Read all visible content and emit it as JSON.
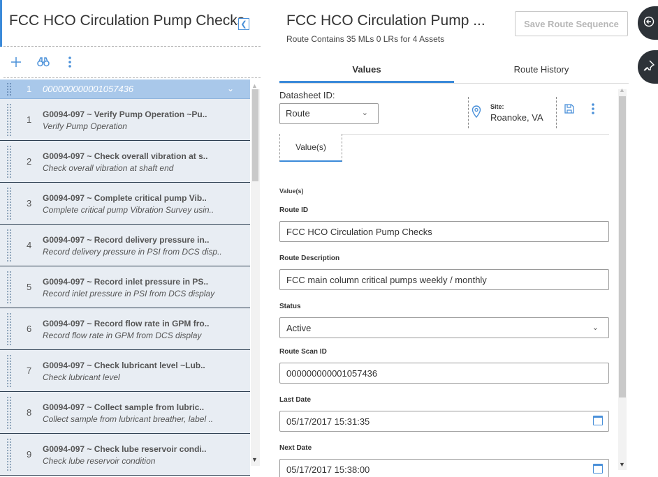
{
  "left": {
    "title": "FCC HCO Circulation Pump Checks",
    "group": {
      "number": "1",
      "label": "000000000001057436"
    },
    "items": [
      {
        "number": "1",
        "title": "G0094-097 ~ Verify Pump Operation ~Pu..",
        "subtitle": "Verify Pump Operation"
      },
      {
        "number": "2",
        "title": "G0094-097 ~ Check overall vibration at s..",
        "subtitle": "Check overall vibration at shaft end"
      },
      {
        "number": "3",
        "title": "G0094-097 ~ Complete critical pump Vib..",
        "subtitle": "Complete critical pump Vibration Survey usin.."
      },
      {
        "number": "4",
        "title": "G0094-097 ~ Record delivery pressure in..",
        "subtitle": "Record delivery pressure in PSI from DCS disp.."
      },
      {
        "number": "5",
        "title": "G0094-097 ~ Record inlet pressure in PS..",
        "subtitle": "Record inlet pressure in PSI from DCS display"
      },
      {
        "number": "6",
        "title": "G0094-097 ~ Record flow rate in GPM fro..",
        "subtitle": "Record flow rate in GPM from DCS display"
      },
      {
        "number": "7",
        "title": "G0094-097 ~ Check lubricant level ~Lub..",
        "subtitle": "Check lubricant level"
      },
      {
        "number": "8",
        "title": "G0094-097 ~ Collect sample from lubric..",
        "subtitle": "Collect sample from lubricant breather, label .."
      },
      {
        "number": "9",
        "title": "G0094-097 ~ Check lube reservoir condi..",
        "subtitle": "Check lube reservoir condition"
      }
    ]
  },
  "header": {
    "title": "FCC HCO Circulation Pump ...",
    "subtitle": "Route Contains 35 MLs 0 LRs for 4 Assets",
    "save_sequence_label": "Save Route Sequence"
  },
  "tabs": [
    {
      "label": "Values"
    },
    {
      "label": "Route History"
    }
  ],
  "datasheet": {
    "label": "Datasheet ID:",
    "value": "Route",
    "site_label": "Site:",
    "site_value": "Roanoke, VA",
    "subtab_label": "Value(s)",
    "section_label": "Value(s)"
  },
  "fields": {
    "route_id": {
      "label": "Route ID",
      "value": "FCC HCO Circulation Pump Checks"
    },
    "route_description": {
      "label": "Route Description",
      "value": "FCC main column critical pumps weekly / monthly"
    },
    "status": {
      "label": "Status",
      "value": "Active"
    },
    "route_scan_id": {
      "label": "Route Scan ID",
      "value": "000000000001057436"
    },
    "last_date": {
      "label": "Last Date",
      "value": "05/17/2017 15:31:35"
    },
    "next_date": {
      "label": "Next Date",
      "value": "05/17/2017 15:38:00"
    }
  },
  "colors": {
    "accent": "#3b8ad9",
    "group_row": "#a9c8ea",
    "item_row": "#e8edf3",
    "side_button": "#2d3238"
  },
  "icons": [
    "collapse-left-icon",
    "add-icon",
    "binoculars-icon",
    "more-vertical-icon",
    "chevron-down-icon",
    "location-pin-icon",
    "save-icon",
    "calendar-icon",
    "sign-out-icon",
    "pin-icon"
  ]
}
